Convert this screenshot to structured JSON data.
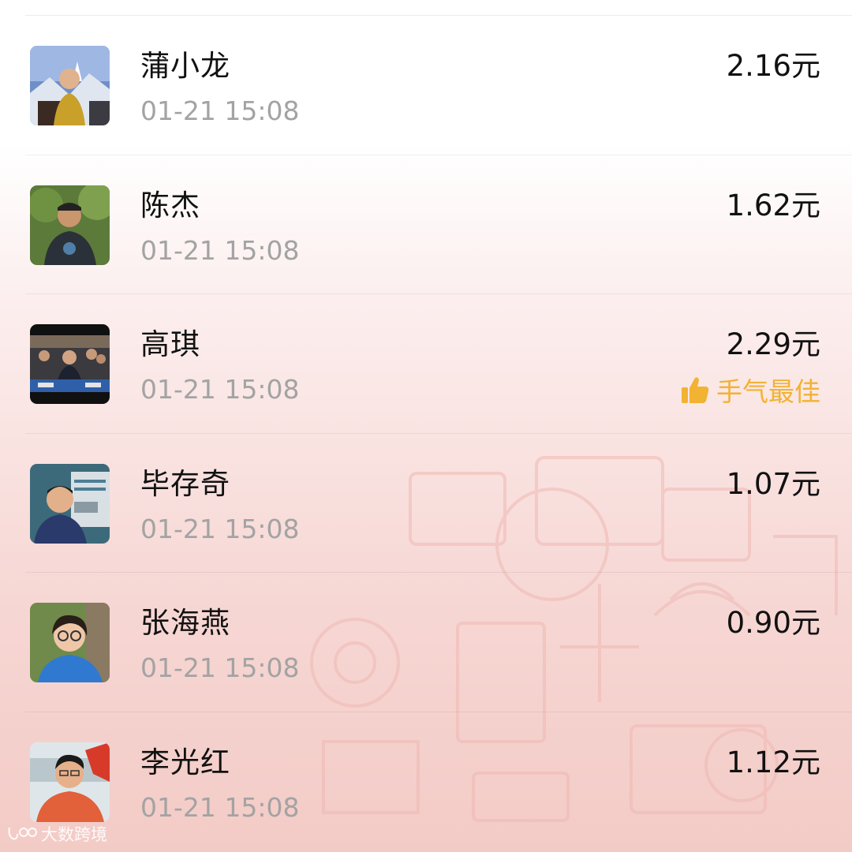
{
  "currency_unit": "元",
  "best_label": "手气最佳",
  "watermark": "大数跨境",
  "colors": {
    "best_accent": "#f2b232",
    "time_text": "#a3a3a3",
    "name_text": "#111111"
  },
  "records": [
    {
      "name": "蒲小龙",
      "time": "01-21 15:08",
      "amount": "2.16元",
      "best": false,
      "avatar_icon": "avatar-photo"
    },
    {
      "name": "陈杰",
      "time": "01-21 15:08",
      "amount": "1.62元",
      "best": false,
      "avatar_icon": "avatar-photo"
    },
    {
      "name": "高琪",
      "time": "01-21 15:08",
      "amount": "2.29元",
      "best": true,
      "avatar_icon": "avatar-photo"
    },
    {
      "name": "毕存奇",
      "time": "01-21 15:08",
      "amount": "1.07元",
      "best": false,
      "avatar_icon": "avatar-photo"
    },
    {
      "name": "张海燕",
      "time": "01-21 15:08",
      "amount": "0.90元",
      "best": false,
      "avatar_icon": "avatar-photo"
    },
    {
      "name": "李光红",
      "time": "01-21 15:08",
      "amount": "1.12元",
      "best": false,
      "avatar_icon": "avatar-photo"
    }
  ]
}
